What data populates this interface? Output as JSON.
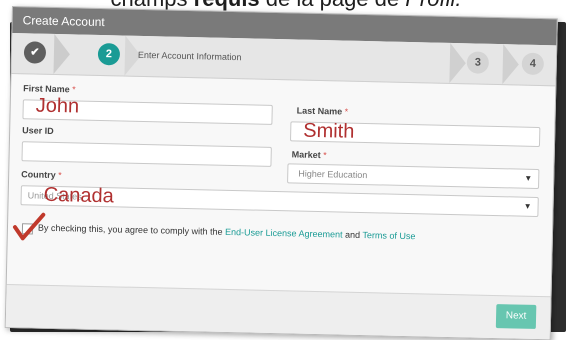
{
  "caption": {
    "before": "champs ",
    "bold": "requis",
    "middle": " de la page de ",
    "italic": "Profil."
  },
  "window": {
    "title": "Create Account"
  },
  "wizard": {
    "steps": [
      {
        "label": "✔",
        "state": "done"
      },
      {
        "label": "2",
        "state": "active"
      },
      {
        "label": "3",
        "state": "pending"
      },
      {
        "label": "4",
        "state": "pending"
      }
    ],
    "active_step_label": "Enter Account Information"
  },
  "form": {
    "first_name": {
      "label": "First Name",
      "required_mark": "*",
      "value": "John"
    },
    "last_name": {
      "label": "Last Name",
      "required_mark": "*",
      "value": "Smith"
    },
    "user_id": {
      "label": "User ID",
      "value": ""
    },
    "market": {
      "label": "Market",
      "required_mark": "*",
      "value": "Higher Education",
      "caret": "▼"
    },
    "country": {
      "label": "Country",
      "required_mark": "*",
      "underlying_value": "United States",
      "value": "Canada",
      "caret": "▼"
    },
    "agreement": {
      "text_before": "By checking this, you agree to comply with the ",
      "eula_link": "End-User License Agreement",
      "text_and": " and ",
      "terms_link": "Terms of Use"
    }
  },
  "footer": {
    "next_label": "Next"
  },
  "colors": {
    "accent": "#1a9b95",
    "handwriting": "#b03030",
    "next_button": "#67c6b0",
    "required": "#d9534f"
  }
}
